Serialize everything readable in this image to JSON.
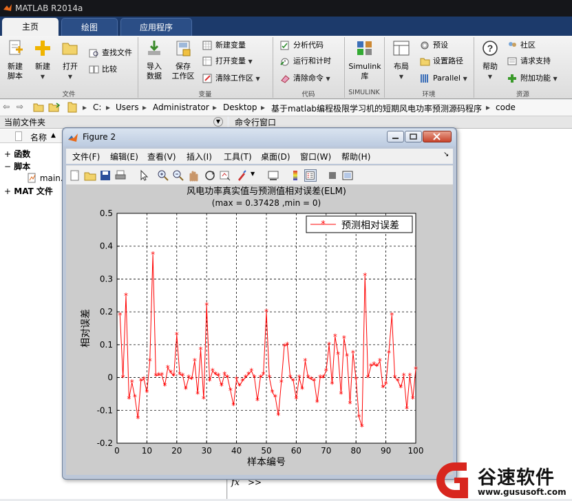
{
  "app": {
    "title": "MATLAB R2014a"
  },
  "tabs": [
    {
      "label": "主页"
    },
    {
      "label": "绘图"
    },
    {
      "label": "应用程序"
    }
  ],
  "ribbon": {
    "new_script": "新建\n脚本",
    "new_script_l1": "新建",
    "new_script_l2": "脚本",
    "new": "新建",
    "open": "打开",
    "find_files": "查找文件",
    "compare": "比较",
    "import_data_l1": "导入",
    "import_data_l2": "数据",
    "save_ws_l1": "保存",
    "save_ws_l2": "工作区",
    "new_variable": "新建变量",
    "open_variable": "打开变量",
    "clear_workspace": "清除工作区",
    "analyze_code": "分析代码",
    "run_and_time": "运行和计时",
    "clear_commands": "清除命令",
    "simulink_l1": "Simulink",
    "simulink_l2": "库",
    "layout": "布局",
    "preferences": "预设",
    "set_path": "设置路径",
    "parallel": "Parallel",
    "help": "帮助",
    "community": "社区",
    "request_support": "请求支持",
    "add_ons": "附加功能",
    "groups": {
      "file": "文件",
      "variable": "变量",
      "code": "代码",
      "simulink": "SIMULINK",
      "environment": "环境",
      "resources": "资源"
    }
  },
  "address": {
    "parts": [
      "C:",
      "Users",
      "Administrator",
      "Desktop",
      "基于matlab编程极限学习机的短期风电功率预测源码程序",
      "code"
    ]
  },
  "left_panel": {
    "title": "当前文件夹",
    "column": "名称",
    "sort_arrow": "▲",
    "items": [
      {
        "label": "函数",
        "expander": "+"
      },
      {
        "label": "脚本",
        "expander": "−"
      },
      {
        "label": "main."
      },
      {
        "label": "MAT 文件",
        "expander": "+"
      }
    ]
  },
  "command_window": {
    "title": "命令行窗口",
    "prompt": ">>",
    "fx": "fx"
  },
  "figure": {
    "title": "Figure 2",
    "menu": [
      "文件(F)",
      "编辑(E)",
      "查看(V)",
      "插入(I)",
      "工具(T)",
      "桌面(D)",
      "窗口(W)",
      "帮助(H)"
    ]
  },
  "watermark": {
    "brand": "谷速软件",
    "url": "www.gususoft.com"
  },
  "colors": {
    "series": "#ff0000",
    "ribbon_tab_bg": "#1c3a6b"
  },
  "chart_data": {
    "type": "line",
    "title": "风电功率真实值与预测值相对误差(ELM)",
    "subtitle": "(max = 0.37428 ,min = 0)",
    "xlabel": "样本编号",
    "ylabel": "相对误差",
    "xlim": [
      0,
      100
    ],
    "ylim": [
      -0.2,
      0.5
    ],
    "xticks": [
      0,
      10,
      20,
      30,
      40,
      50,
      60,
      70,
      80,
      90,
      100
    ],
    "yticks": [
      -0.2,
      -0.1,
      0,
      0.1,
      0.2,
      0.3,
      0.4,
      0.5
    ],
    "grid": true,
    "legend_position": "top-right",
    "series": [
      {
        "name": "预测相对误差",
        "marker": "*",
        "x": [
          1,
          2,
          3,
          4,
          5,
          6,
          7,
          8,
          9,
          10,
          11,
          12,
          13,
          14,
          15,
          16,
          17,
          18,
          19,
          20,
          21,
          22,
          23,
          24,
          25,
          26,
          27,
          28,
          29,
          30,
          31,
          32,
          33,
          34,
          35,
          36,
          37,
          38,
          39,
          40,
          41,
          42,
          43,
          44,
          45,
          46,
          47,
          48,
          49,
          50,
          51,
          52,
          53,
          54,
          55,
          56,
          57,
          58,
          59,
          60,
          61,
          62,
          63,
          64,
          65,
          66,
          67,
          68,
          69,
          70,
          71,
          72,
          73,
          74,
          75,
          76,
          77,
          78,
          79,
          80,
          81,
          82,
          83,
          84,
          85,
          86,
          87,
          88,
          89,
          90,
          91,
          92,
          93,
          94,
          95,
          96,
          97,
          98,
          99,
          100
        ],
        "y": [
          0.19,
          0.0,
          0.25,
          -0.065,
          -0.015,
          -0.06,
          -0.125,
          -0.01,
          -0.005,
          -0.045,
          0.05,
          0.375,
          0.005,
          0.008,
          0.007,
          -0.025,
          0.03,
          0.015,
          0.005,
          0.13,
          0.01,
          0.005,
          -0.035,
          0.0,
          -0.005,
          0.05,
          -0.05,
          0.085,
          -0.065,
          0.22,
          -0.01,
          0.02,
          0.01,
          0.005,
          -0.025,
          0.01,
          0.0,
          -0.04,
          -0.085,
          -0.005,
          -0.025,
          -0.01,
          0.0,
          0.01,
          0.02,
          0.0,
          -0.07,
          0.0,
          0.01,
          0.2,
          0.0,
          -0.045,
          -0.06,
          -0.115,
          -0.015,
          0.095,
          0.1,
          0.0,
          -0.01,
          -0.065,
          0.0,
          -0.035,
          0.05,
          0.0,
          -0.005,
          -0.01,
          -0.075,
          0.0,
          0.0,
          0.02,
          0.1,
          -0.02,
          0.125,
          0.07,
          -0.05,
          0.12,
          0.065,
          -0.08,
          0.075,
          -0.005,
          -0.12,
          -0.15,
          0.31,
          0.0,
          0.035,
          0.04,
          0.035,
          0.05,
          -0.03,
          -0.02,
          0.075,
          0.19,
          0.0,
          -0.01,
          -0.03,
          0.005,
          -0.095,
          0.005,
          -0.065,
          0.025
        ]
      }
    ]
  }
}
